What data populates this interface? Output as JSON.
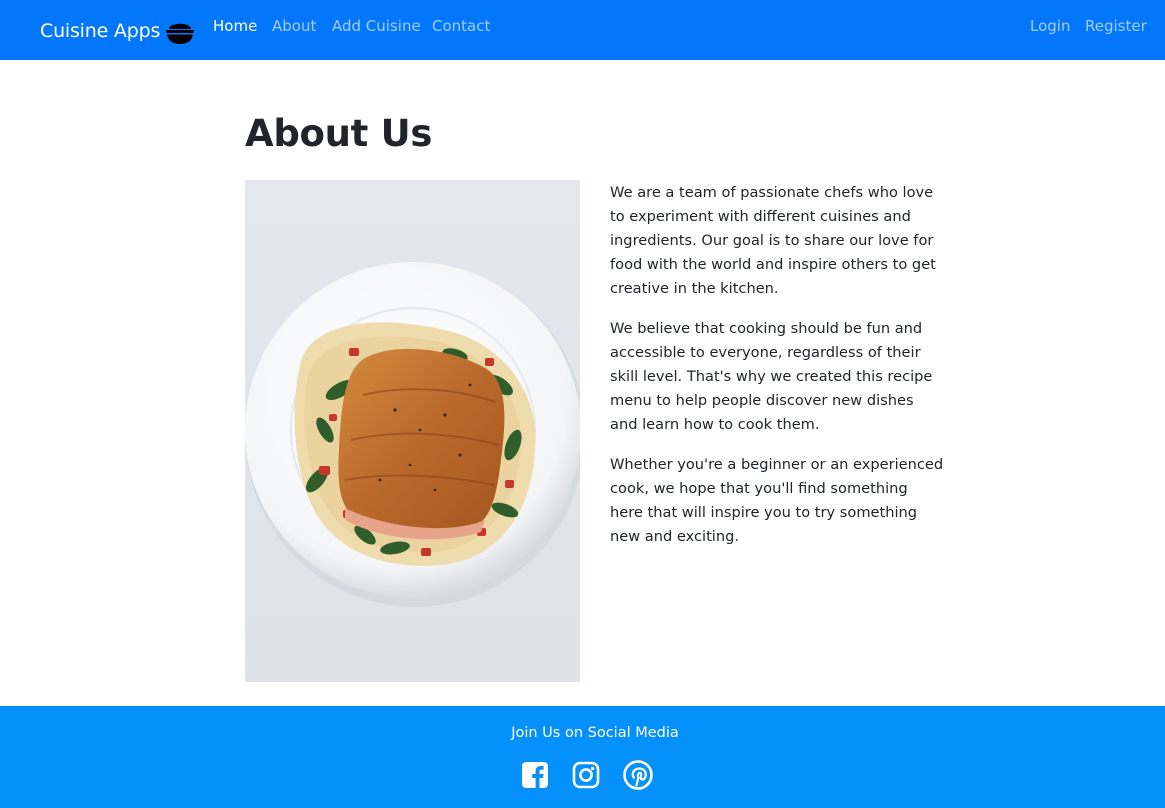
{
  "navbar": {
    "brand": "Cuisine Apps",
    "brand_icon": "rice-bowl-icon",
    "links": [
      "Home",
      "About",
      "Add Cuisine",
      "Contact"
    ],
    "auth_links": [
      "Login",
      "Register"
    ],
    "active_link": "Home"
  },
  "about": {
    "title": "About Us",
    "image_subject": "seared-salmon-plate",
    "paragraphs": [
      "We are a team of passionate chefs who love to experiment with different cuisines and ingredients. Our goal is to share our love for food with the world and inspire others to get creative in the kitchen.",
      "We believe that cooking should be fun and accessible to everyone, regardless of their skill level. That's why we created this recipe menu to help people discover new dishes and learn how to cook them.",
      "Whether you're a beginner or an experienced cook, we hope that you'll find something here that will inspire you to try something new and exciting."
    ]
  },
  "footer": {
    "title": "Join Us on Social Media",
    "social_icons": [
      "facebook-icon",
      "instagram-icon",
      "pinterest-icon"
    ]
  },
  "colors": {
    "navbar": "#0377fc",
    "footer": "#0591fc",
    "text": "#212529",
    "nav_inactive": "rgba(255,255,255,0.62)"
  }
}
